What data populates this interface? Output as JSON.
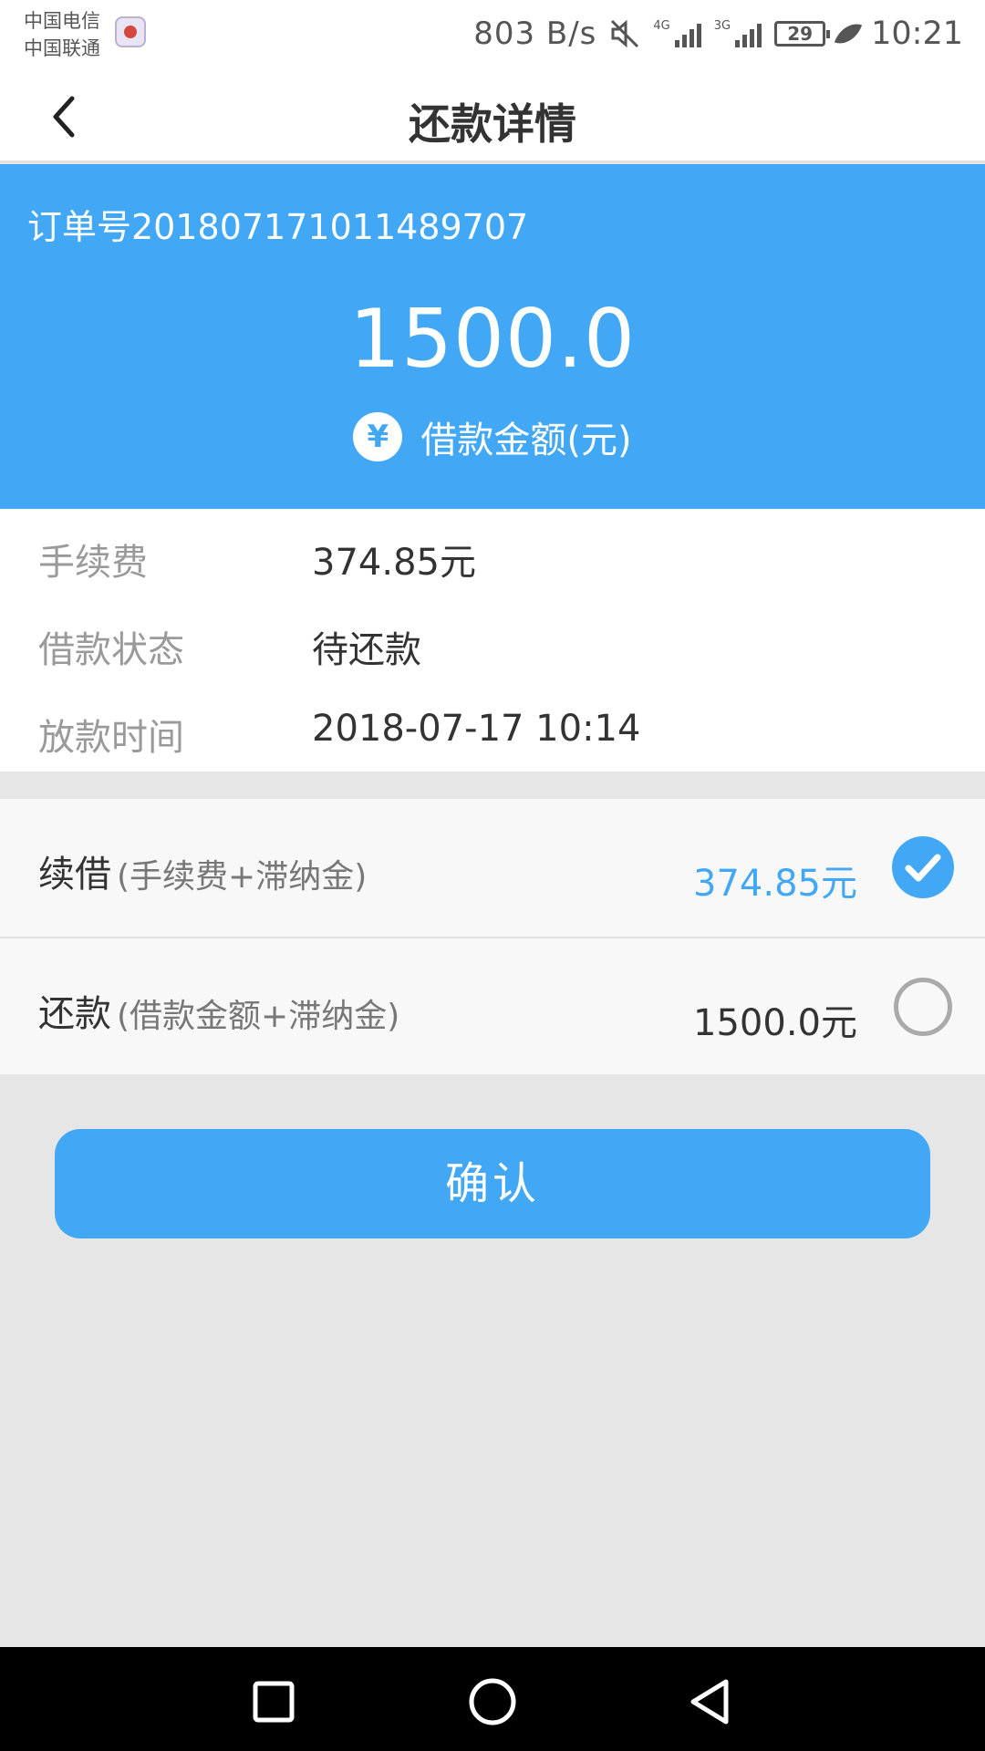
{
  "status_bar": {
    "carrier_1": "中国电信",
    "carrier_2": "中国联通",
    "net_speed": "803 B/s",
    "network_tag_1": "4G",
    "network_tag_2": "3G",
    "battery": "29",
    "time": "10:21",
    "icons": [
      "mute-icon",
      "signal-icon",
      "battery-icon",
      "leaf-icon"
    ]
  },
  "header": {
    "title": "还款详情"
  },
  "summary": {
    "order_no": "订单号20180717101148970​7",
    "amount": "1500.0",
    "amount_label": "借款金额(元)",
    "currency_icon": "¥",
    "accent_color": "#42a8f5"
  },
  "details": [
    {
      "label": "手续费",
      "value": "374.85元"
    },
    {
      "label": "借款状态",
      "value": "待还款"
    },
    {
      "label": "放款时间",
      "value": "2018-07-17 10:14"
    }
  ],
  "options": [
    {
      "name": "续借",
      "desc": "(手续费+滞纳金)",
      "amount": "374.85元",
      "selected": true
    },
    {
      "name": "还款",
      "desc": "(借款金额+滞纳金)",
      "amount": "1500.0元",
      "selected": false
    }
  ],
  "confirm_label": "确认"
}
